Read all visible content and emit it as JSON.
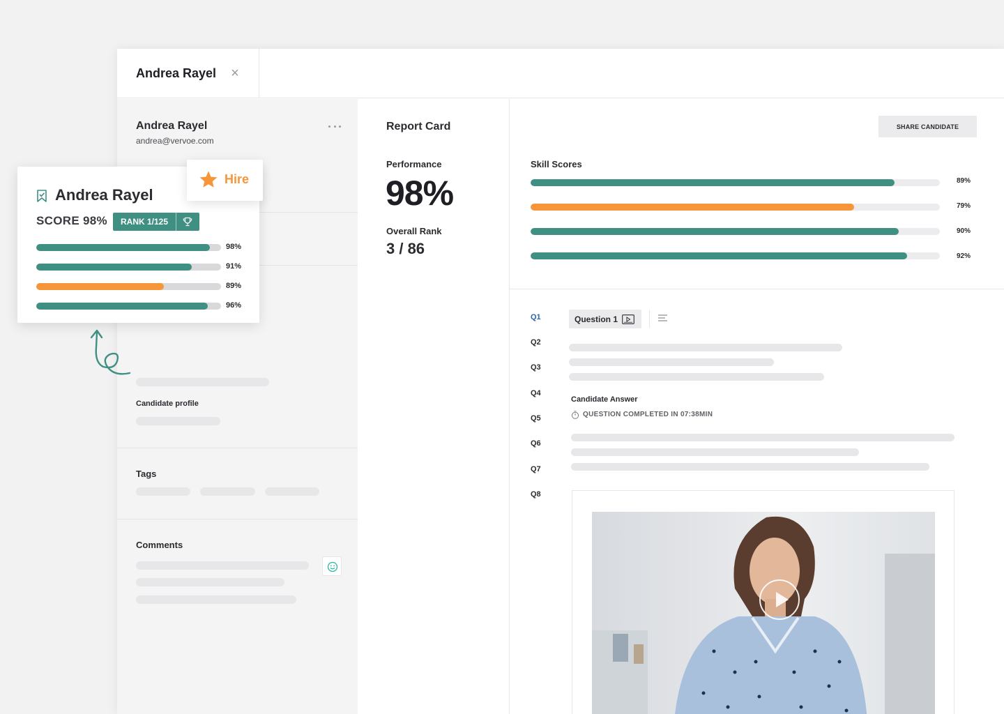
{
  "tab": {
    "title": "Andrea Rayel",
    "close_icon": "close-icon"
  },
  "candidate": {
    "name": "Andrea Rayel",
    "email": "andrea@vervoe.com",
    "profile_label": "Candidate profile",
    "tags_label": "Tags",
    "comments_label": "Comments"
  },
  "report": {
    "title": "Report Card",
    "performance_label": "Performance",
    "performance_value": "98%",
    "rank_label": "Overall Rank",
    "rank_value": "3 / 86"
  },
  "skills": {
    "share_label": "SHARE CANDIDATE",
    "title": "Skill Scores",
    "bars": [
      {
        "value": 0.89,
        "label": "89%",
        "color": "#3f8f82"
      },
      {
        "value": 0.79,
        "label": "79%",
        "color": "#f7953a"
      },
      {
        "value": 0.9,
        "label": "90%",
        "color": "#3f8f82"
      },
      {
        "value": 0.92,
        "label": "92%",
        "color": "#3f8f82"
      }
    ]
  },
  "questions": {
    "items": [
      "Q1",
      "Q2",
      "Q3",
      "Q4",
      "Q5",
      "Q6",
      "Q7",
      "Q8"
    ],
    "active": "Q1",
    "chip_label": "Question 1",
    "answer_title": "Candidate Answer",
    "answer_status": "QUESTION COMPLETED IN 07:38MIN"
  },
  "score_card": {
    "name": "Andrea Rayel",
    "score": "SCORE 98%",
    "rank": "RANK 1/125",
    "bars": [
      {
        "value": 0.94,
        "label": "98%",
        "color": "#3f8f82"
      },
      {
        "value": 0.84,
        "label": "91%",
        "color": "#3f8f82"
      },
      {
        "value": 0.69,
        "label": "89%",
        "color": "#f7953a"
      },
      {
        "value": 0.93,
        "label": "96%",
        "color": "#3f8f82"
      }
    ]
  },
  "hire": {
    "label": "Hire",
    "icon": "star-icon",
    "color": "#f7953a"
  },
  "colors": {
    "accent_green": "#3f8f82",
    "accent_orange": "#f7953a",
    "link_blue": "#2a63b5"
  }
}
